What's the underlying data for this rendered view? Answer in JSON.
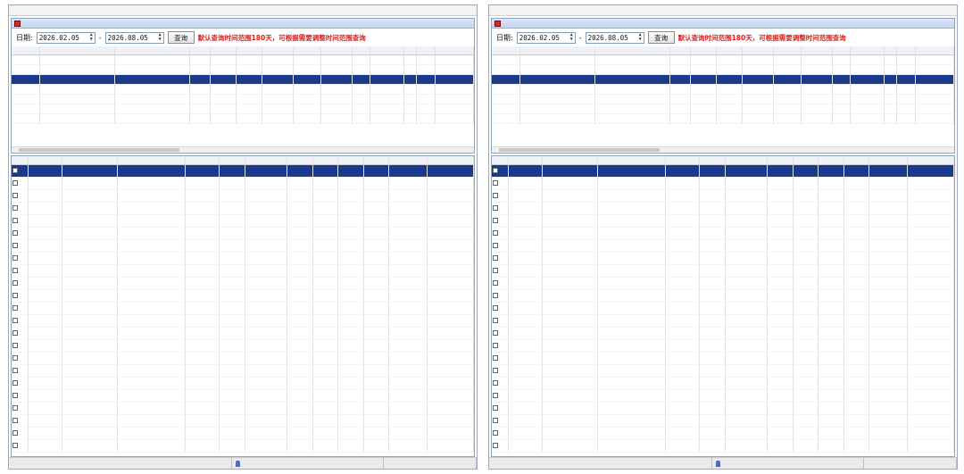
{
  "left": {
    "menu": [
      "",
      "",
      "",
      "",
      "",
      "",
      "",
      "",
      "",
      "",
      "",
      "",
      "",
      "",
      "",
      ""
    ],
    "title": "",
    "toolbar": {
      "date_label": "日期:",
      "start_date": "2026.02.05",
      "end_date": "2026.08.05",
      "query_label": "查询",
      "notice": "默认查询时间范围180天，可根据需要调整时间范围查询"
    },
    "records": {
      "columns": [
        "",
        "",
        "",
        "",
        "",
        "",
        "",
        "",
        "",
        "",
        "",
        "",
        "",
        ""
      ],
      "rows": [
        [
          "",
          "",
          "",
          "",
          "",
          "",
          "",
          "",
          "",
          "",
          "",
          "",
          "",
          ""
        ],
        [
          "",
          "",
          "",
          "",
          "",
          "",
          "",
          "",
          "",
          "",
          "",
          "",
          "",
          ""
        ],
        [
          "",
          "",
          "",
          "",
          "",
          "",
          "",
          "",
          "",
          "",
          "",
          "",
          "",
          ""
        ],
        [
          "",
          "",
          "",
          "",
          "",
          "",
          "",
          "",
          "",
          "",
          "",
          "",
          "",
          ""
        ],
        [
          "",
          "",
          "",
          "",
          "",
          "",
          "",
          "",
          "",
          "",
          "",
          "",
          "",
          ""
        ],
        [
          "",
          "",
          "",
          "",
          "",
          "",
          "",
          "",
          "",
          "",
          "",
          "",
          "",
          ""
        ],
        [
          "",
          "",
          "",
          "",
          "",
          "",
          "",
          "",
          "",
          "",
          "",
          "",
          "",
          ""
        ]
      ]
    },
    "results": {
      "columns": [
        "",
        "",
        "",
        "",
        "",
        "",
        "",
        "",
        "",
        "",
        "",
        "",
        ""
      ],
      "rows": [
        [
          "",
          "",
          "",
          "",
          "",
          "",
          "",
          "",
          "",
          "",
          "",
          "",
          ""
        ],
        [
          "",
          "",
          "",
          "",
          "",
          "",
          "",
          "",
          "",
          "",
          "",
          "",
          ""
        ],
        [
          "",
          "",
          "",
          "",
          "",
          "",
          "",
          "",
          "",
          "",
          "",
          "",
          ""
        ],
        [
          "",
          "",
          "",
          "",
          "",
          "",
          "",
          "",
          "",
          "",
          "",
          "",
          ""
        ],
        [
          "",
          "",
          "",
          "",
          "",
          "",
          "",
          "",
          "",
          "",
          "",
          "",
          ""
        ],
        [
          "",
          "",
          "",
          "",
          "",
          "",
          "",
          "",
          "",
          "",
          "",
          "",
          ""
        ],
        [
          "",
          "",
          "",
          "",
          "",
          "",
          "",
          "",
          "",
          "",
          "",
          "",
          ""
        ],
        [
          "",
          "",
          "",
          "",
          "",
          "",
          "",
          "",
          "",
          "",
          "",
          "",
          ""
        ],
        [
          "",
          "",
          "",
          "",
          "",
          "",
          "",
          "",
          "",
          "",
          "",
          "",
          ""
        ],
        [
          "",
          "",
          "",
          "",
          "",
          "",
          "",
          "",
          "",
          "",
          "",
          "",
          ""
        ],
        [
          "",
          "",
          "",
          "",
          "",
          "",
          "",
          "",
          "",
          "",
          "",
          "",
          ""
        ],
        [
          "",
          "",
          "",
          "",
          "",
          "",
          "",
          "",
          "",
          "",
          "",
          "",
          ""
        ],
        [
          "",
          "",
          "",
          "",
          "",
          "",
          "",
          "",
          "",
          "",
          "",
          "",
          ""
        ],
        [
          "",
          "",
          "",
          "",
          "",
          "",
          "",
          "",
          "",
          "",
          "",
          "",
          ""
        ],
        [
          "",
          "",
          "",
          "",
          "",
          "",
          "",
          "",
          "",
          "",
          "",
          "",
          ""
        ],
        [
          "",
          "",
          "",
          "",
          "",
          "",
          "",
          "",
          "",
          "",
          "",
          "",
          ""
        ],
        [
          "",
          "",
          "",
          "",
          "",
          "",
          "",
          "",
          "",
          "",
          "",
          "",
          ""
        ],
        [
          "",
          "",
          "",
          "",
          "",
          "",
          "",
          "",
          "",
          "",
          "",
          "",
          ""
        ],
        [
          "",
          "",
          "",
          "",
          "",
          "",
          "",
          "",
          "",
          "",
          "",
          "",
          ""
        ],
        [
          "",
          "",
          "",
          "",
          "",
          "",
          "",
          "",
          "",
          "",
          "",
          "",
          ""
        ],
        [
          "",
          "",
          "",
          "",
          "",
          "",
          "",
          "",
          "",
          "",
          "",
          "",
          ""
        ],
        [
          "",
          "",
          "",
          "",
          "",
          "",
          "",
          "",
          "",
          "",
          "",
          "",
          ""
        ],
        [
          "",
          "",
          "",
          "",
          "",
          "",
          "",
          "",
          "",
          "",
          "",
          "",
          ""
        ]
      ]
    },
    "status": [
      "",
      "",
      ""
    ]
  },
  "right": {
    "menu": [
      "",
      "",
      "",
      "",
      "",
      "",
      "",
      "",
      "",
      "",
      "",
      "",
      "",
      "",
      "",
      ""
    ],
    "title": "",
    "toolbar": {
      "date_label": "日期:",
      "start_date": "2026.02.05",
      "end_date": "2026.08.05",
      "query_label": "查询",
      "notice": "默认查询时间范围180天，可根据需要调整时间范围查询"
    },
    "records": {
      "columns": [
        "",
        "",
        "",
        "",
        "",
        "",
        "",
        "",
        "",
        "",
        "",
        "",
        "",
        ""
      ],
      "rows": [
        [
          "",
          "",
          "",
          "",
          "",
          "",
          "",
          "",
          "",
          "",
          "",
          "",
          "",
          ""
        ],
        [
          "",
          "",
          "",
          "",
          "",
          "",
          "",
          "",
          "",
          "",
          "",
          "",
          "",
          ""
        ],
        [
          "",
          "",
          "",
          "",
          "",
          "",
          "",
          "",
          "",
          "",
          "",
          "",
          "",
          ""
        ],
        [
          "",
          "",
          "",
          "",
          "",
          "",
          "",
          "",
          "",
          "",
          "",
          "",
          "",
          ""
        ],
        [
          "",
          "",
          "",
          "",
          "",
          "",
          "",
          "",
          "",
          "",
          "",
          "",
          "",
          ""
        ],
        [
          "",
          "",
          "",
          "",
          "",
          "",
          "",
          "",
          "",
          "",
          "",
          "",
          "",
          ""
        ],
        [
          "",
          "",
          "",
          "",
          "",
          "",
          "",
          "",
          "",
          "",
          "",
          "",
          "",
          ""
        ]
      ]
    },
    "results": {
      "columns": [
        "",
        "",
        "",
        "",
        "",
        "",
        "",
        "",
        "",
        "",
        "",
        "",
        ""
      ],
      "rows": [
        [
          "",
          "",
          "",
          "",
          "",
          "",
          "",
          "",
          "",
          "",
          "",
          "",
          ""
        ],
        [
          "",
          "",
          "",
          "",
          "",
          "",
          "",
          "",
          "",
          "",
          "",
          "",
          ""
        ],
        [
          "",
          "",
          "",
          "",
          "",
          "",
          "",
          "",
          "",
          "",
          "",
          "",
          ""
        ],
        [
          "",
          "",
          "",
          "",
          "",
          "",
          "",
          "",
          "",
          "",
          "",
          "",
          ""
        ],
        [
          "",
          "",
          "",
          "",
          "",
          "",
          "",
          "",
          "",
          "",
          "",
          "",
          ""
        ],
        [
          "",
          "",
          "",
          "",
          "",
          "",
          "",
          "",
          "",
          "",
          "",
          "",
          ""
        ],
        [
          "",
          "",
          "",
          "",
          "",
          "",
          "",
          "",
          "",
          "",
          "",
          "",
          ""
        ],
        [
          "",
          "",
          "",
          "",
          "",
          "",
          "",
          "",
          "",
          "",
          "",
          "",
          ""
        ],
        [
          "",
          "",
          "",
          "",
          "",
          "",
          "",
          "",
          "",
          "",
          "",
          "",
          ""
        ],
        [
          "",
          "",
          "",
          "",
          "",
          "",
          "",
          "",
          "",
          "",
          "",
          "",
          ""
        ],
        [
          "",
          "",
          "",
          "",
          "",
          "",
          "",
          "",
          "",
          "",
          "",
          "",
          ""
        ],
        [
          "",
          "",
          "",
          "",
          "",
          "",
          "",
          "",
          "",
          "",
          "",
          "",
          ""
        ],
        [
          "",
          "",
          "",
          "",
          "",
          "",
          "",
          "",
          "",
          "",
          "",
          "",
          ""
        ],
        [
          "",
          "",
          "",
          "",
          "",
          "",
          "",
          "",
          "",
          "",
          "",
          "",
          ""
        ],
        [
          "",
          "",
          "",
          "",
          "",
          "",
          "",
          "",
          "",
          "",
          "",
          "",
          ""
        ],
        [
          "",
          "",
          "",
          "",
          "",
          "",
          "",
          "",
          "",
          "",
          "",
          "",
          ""
        ],
        [
          "",
          "",
          "",
          "",
          "",
          "",
          "",
          "",
          "",
          "",
          "",
          "",
          ""
        ],
        [
          "",
          "",
          "",
          "",
          "",
          "",
          "",
          "",
          "",
          "",
          "",
          "",
          ""
        ],
        [
          "",
          "",
          "",
          "",
          "",
          "",
          "",
          "",
          "",
          "",
          "",
          "",
          ""
        ],
        [
          "",
          "",
          "",
          "",
          "",
          "",
          "",
          "",
          "",
          "",
          "",
          "",
          ""
        ],
        [
          "",
          "",
          "",
          "",
          "",
          "",
          "",
          "",
          "",
          "",
          "",
          "",
          ""
        ],
        [
          "",
          "",
          "",
          "",
          "",
          "",
          "",
          "",
          "",
          "",
          "",
          "",
          ""
        ],
        [
          "",
          "",
          "",
          "",
          "",
          "",
          "",
          "",
          "",
          "",
          "",
          "",
          ""
        ]
      ]
    },
    "status": [
      "",
      "",
      ""
    ]
  }
}
